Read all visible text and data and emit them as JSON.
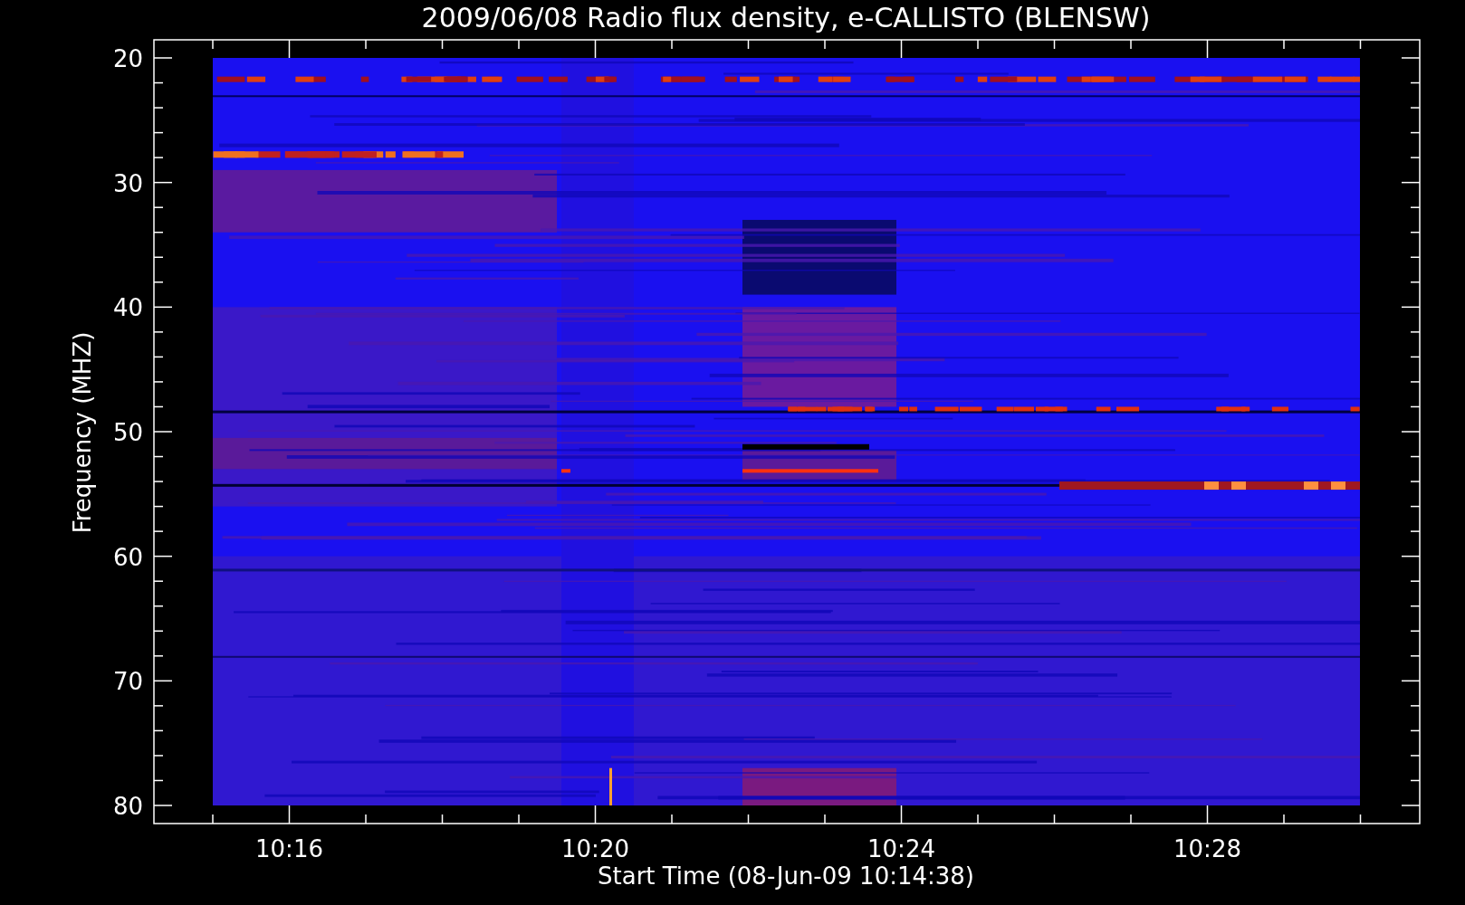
{
  "title": "2009/06/08  Radio flux density, e-CALLISTO (BLENSW)",
  "x_axis": {
    "label": "Start Time (08-Jun-09 10:14:38)",
    "ticks": [
      "10:16",
      "10:20",
      "10:24",
      "10:28"
    ]
  },
  "y_axis": {
    "label": "Frequency (MHZ)",
    "ticks": [
      "20",
      "30",
      "40",
      "50",
      "60",
      "70",
      "80"
    ]
  }
}
